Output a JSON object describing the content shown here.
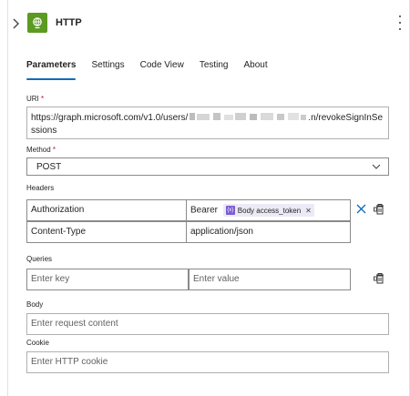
{
  "header": {
    "title": "HTTP",
    "expand_icon": "chevron-right-icon",
    "app_icon": "globe-icon",
    "brand_color": "#5c9a22",
    "more_icon": "more-vertical-icon"
  },
  "tabs": [
    {
      "label": "Parameters",
      "active": true
    },
    {
      "label": "Settings",
      "active": false
    },
    {
      "label": "Code View",
      "active": false
    },
    {
      "label": "Testing",
      "active": false
    },
    {
      "label": "About",
      "active": false
    }
  ],
  "uri": {
    "label": "URI",
    "required_mark": "*",
    "value_start": "https://graph.microsoft.com/v1.0/users/",
    "value_end": ".n/revokeSignInSessions"
  },
  "method": {
    "label": "Method",
    "required_mark": "*",
    "value": "POST"
  },
  "headers": {
    "label": "Headers",
    "rows": [
      {
        "key": "Authorization",
        "value_prefix": "Bearer",
        "token": "Body access_token"
      },
      {
        "key": "Content-Type",
        "value": "application/json"
      }
    ]
  },
  "queries": {
    "label": "Queries",
    "key_placeholder": "Enter key",
    "value_placeholder": "Enter value"
  },
  "body": {
    "label": "Body",
    "placeholder": "Enter request content"
  },
  "cookie": {
    "label": "Cookie",
    "placeholder": "Enter HTTP cookie"
  },
  "colors": {
    "accent": "#0f6cbd",
    "token_bg": "#eceaf6",
    "token_icon": "#7a5bd4",
    "required": "#c50f1f"
  }
}
